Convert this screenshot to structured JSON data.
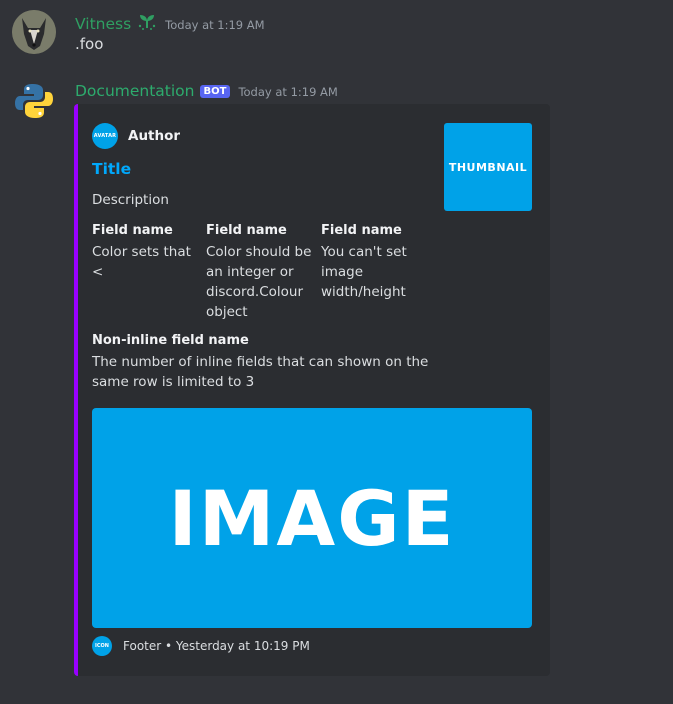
{
  "messages": [
    {
      "username": "Vitness",
      "timestamp": "Today at 1:19 AM",
      "content": ".foo"
    },
    {
      "username": "Documentation",
      "badge": "BOT",
      "timestamp": "Today at 1:19 AM",
      "embed": {
        "accent_color": "#9900ff",
        "author": {
          "icon_text": "AVATAR",
          "name": "Author"
        },
        "title": "Title",
        "description": "Description",
        "fields": [
          {
            "name": "Field name",
            "value": "Color sets that <"
          },
          {
            "name": "Field name",
            "value": "Color should be an integer or discord.Colour object"
          },
          {
            "name": "Field name",
            "value": "You can't set image width/height"
          }
        ],
        "non_inline_field": {
          "name": "Non-inline field name",
          "value": "The number of inline fields that can shown on the same row is limited to 3"
        },
        "thumbnail_text": "THUMBNAIL",
        "image_text": "IMAGE",
        "footer": {
          "icon_text": "ICON",
          "text": "Footer • Yesterday at 10:19 PM"
        }
      }
    }
  ],
  "colors": {
    "background": "#313338",
    "embed_bg": "#2b2d31",
    "image_blue": "#00a2e8",
    "title_link": "#00a8fc",
    "bot_badge": "#5865f2"
  },
  "icons": [
    "wolf-avatar",
    "python-logo-avatar",
    "sprout-icon"
  ]
}
